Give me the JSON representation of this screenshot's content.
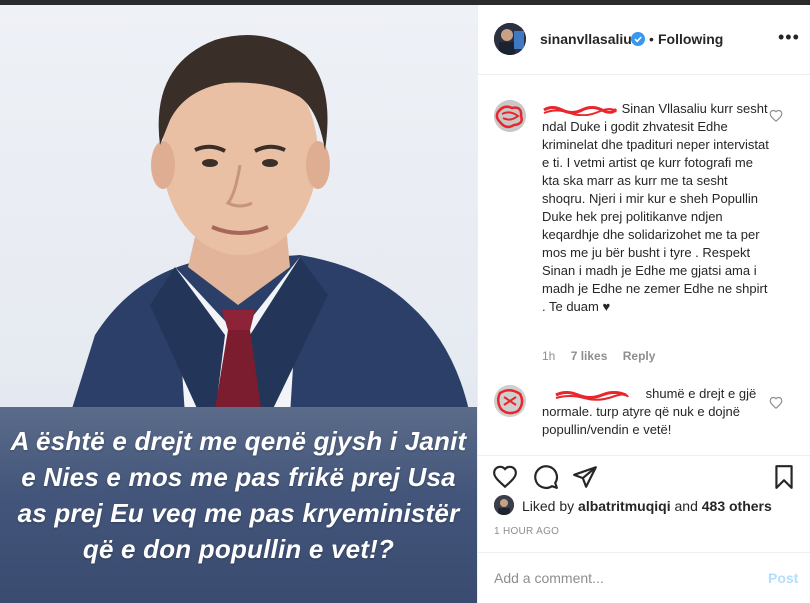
{
  "post": {
    "caption": "A është e drejt me qenë gjysh i Janit e Nies e mos me pas frikë prej Usa  as  prej Eu veq me pas kryeministër që e don popullin e vet!?"
  },
  "header": {
    "username": "sinanvllasaliu",
    "separator": "•",
    "follow_state": "Following",
    "more": "•••"
  },
  "comments": [
    {
      "text": "Sinan Vllasaliu kurr sesht ndal Duke i godit zhvatesit Edhe kriminelat dhe tpadituri neper intervistat e ti. I vetmi artist qe kurr fotografi me kta ska marr as kurr me ta sesht shoqru. Njeri i mir kur e sheh Popullin Duke hek prej politikanve ndjen keqardhje dhe solidarizohet me ta per mos me ju bër busht i tyre . Respekt Sinan i madh je Edhe me gjatsi ama i madh je Edhe ne zemer Edhe ne shpirt . Te duam ♥",
      "time": "1h",
      "likes": "7 likes",
      "reply": "Reply"
    },
    {
      "text": "shumë e drejt e gjë normale. turp atyre që nuk e dojnë popullin/vendin e vetë!"
    }
  ],
  "liked_by": {
    "prefix": "Liked by ",
    "user": "albatritmuqiqi",
    "middle": " and ",
    "others": "483 others"
  },
  "timestamp": "1 HOUR AGO",
  "add_comment": {
    "placeholder": "Add a comment...",
    "post_label": "Post"
  },
  "colors": {
    "verified": "#3897f0",
    "redaction": "#e8262b",
    "post_button_disabled": "#b2dffc",
    "caption_band": "#43557a"
  },
  "icons": [
    "heart-icon",
    "comment-icon",
    "share-icon",
    "bookmark-icon",
    "verified-badge-icon",
    "more-options-icon"
  ]
}
